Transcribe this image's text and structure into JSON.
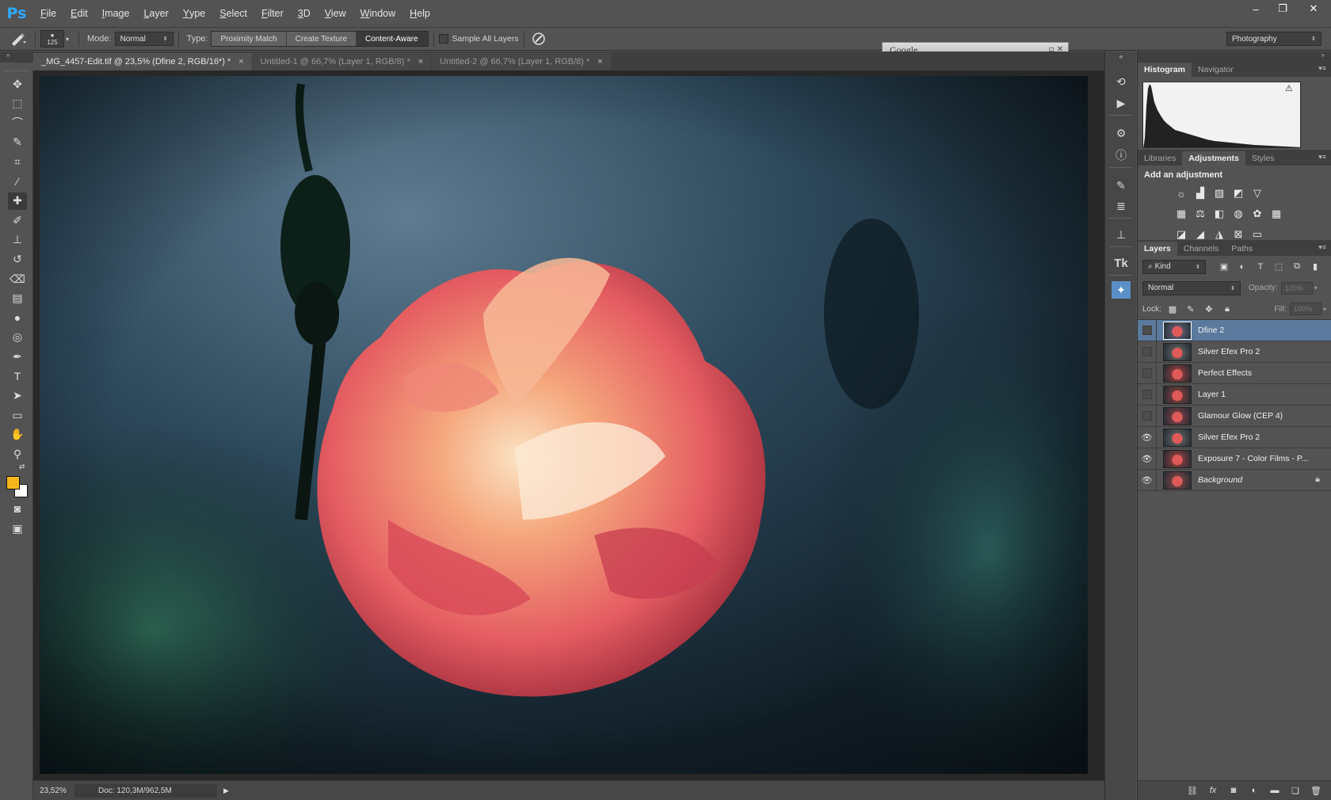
{
  "app": {
    "logo": "Ps"
  },
  "menu": [
    {
      "label": "File",
      "mnemonic": "F",
      "rest": "ile"
    },
    {
      "label": "Edit",
      "mnemonic": "E",
      "rest": "dit"
    },
    {
      "label": "Image",
      "mnemonic": "I",
      "rest": "mage"
    },
    {
      "label": "Layer",
      "mnemonic": "L",
      "rest": "ayer"
    },
    {
      "label": "Type",
      "mnemonic": "Y",
      "rest": "ype"
    },
    {
      "label": "Select",
      "mnemonic": "S",
      "rest": "elect"
    },
    {
      "label": "Filter",
      "mnemonic": "F",
      "rest": "ilter"
    },
    {
      "label": "3D",
      "mnemonic": "3",
      "rest": "D"
    },
    {
      "label": "View",
      "mnemonic": "V",
      "rest": "iew"
    },
    {
      "label": "Window",
      "mnemonic": "W",
      "rest": "indow"
    },
    {
      "label": "Help",
      "mnemonic": "H",
      "rest": "elp"
    }
  ],
  "window_controls": {
    "minimize": "–",
    "restore": "❐",
    "close": "✕"
  },
  "options": {
    "brush_size": "125",
    "mode_label": "Mode:",
    "mode_value": "Normal",
    "type_label": "Type:",
    "type_buttons": [
      "Proximity Match",
      "Create Texture",
      "Content-Aware"
    ],
    "sample_all_layers": "Sample All Layers",
    "workspace": "Photography"
  },
  "google_panel": {
    "title": "Google",
    "controls": "▫ ✕"
  },
  "tabs": [
    {
      "title": "_MG_4457-Edit.tif @ 23,5% (Dfine 2, RGB/16*) *",
      "active": true
    },
    {
      "title": "Untitled-1 @ 66,7% (Layer 1, RGB/8) *",
      "active": false
    },
    {
      "title": "Untitled-2 @ 66,7% (Layer 1, RGB/8) *",
      "active": false
    }
  ],
  "tab_close": "×",
  "status": {
    "zoom": "23,52%",
    "doc": "Doc: 120,3M/962,5M",
    "arrow": "▶"
  },
  "colors": {
    "foreground": "#f5b81c",
    "background": "#ffffff",
    "selection": "#5b7a9d"
  },
  "panels": {
    "histogram_tabs": [
      "Histogram",
      "Navigator"
    ],
    "adjustment_tabs": [
      "Libraries",
      "Adjustments",
      "Styles"
    ],
    "add_adjustment": "Add an adjustment",
    "layer_tabs": [
      "Layers",
      "Channels",
      "Paths"
    ],
    "filter_kind": "Kind",
    "blend_mode": "Normal",
    "opacity_label": "Opacity:",
    "opacity_value": "100%",
    "lock_label": "Lock:",
    "fill_label": "Fill:",
    "fill_value": "100%",
    "menu_glyph": "▾≡",
    "warning_glyph": "⚠"
  },
  "layers": [
    {
      "name": "Dfine 2",
      "visible": false,
      "selected": true,
      "italic": false,
      "locked": false
    },
    {
      "name": "Silver Efex Pro 2",
      "visible": false,
      "selected": false,
      "italic": false,
      "locked": false
    },
    {
      "name": "Perfect Effects",
      "visible": false,
      "selected": false,
      "italic": false,
      "locked": false
    },
    {
      "name": "Layer 1",
      "visible": false,
      "selected": false,
      "italic": false,
      "locked": false
    },
    {
      "name": "Glamour Glow (CEP 4)",
      "visible": false,
      "selected": false,
      "italic": false,
      "locked": false
    },
    {
      "name": "Silver Efex Pro 2",
      "visible": true,
      "selected": false,
      "italic": false,
      "locked": false
    },
    {
      "name": "Exposure 7 - Color Films - P...",
      "visible": true,
      "selected": false,
      "italic": false,
      "locked": false
    },
    {
      "name": "Background",
      "visible": true,
      "selected": false,
      "italic": true,
      "locked": true
    }
  ],
  "icons": {
    "tools": [
      "move-icon",
      "marquee-icon",
      "lasso-icon",
      "quick-select-icon",
      "crop-icon",
      "eyedropper-icon",
      "healing-brush-icon",
      "brush-icon",
      "clone-stamp-icon",
      "history-brush-icon",
      "eraser-icon",
      "gradient-icon",
      "blur-icon",
      "dodge-icon",
      "pen-icon",
      "type-icon",
      "path-select-icon",
      "shape-icon",
      "hand-icon",
      "zoom-icon"
    ]
  }
}
